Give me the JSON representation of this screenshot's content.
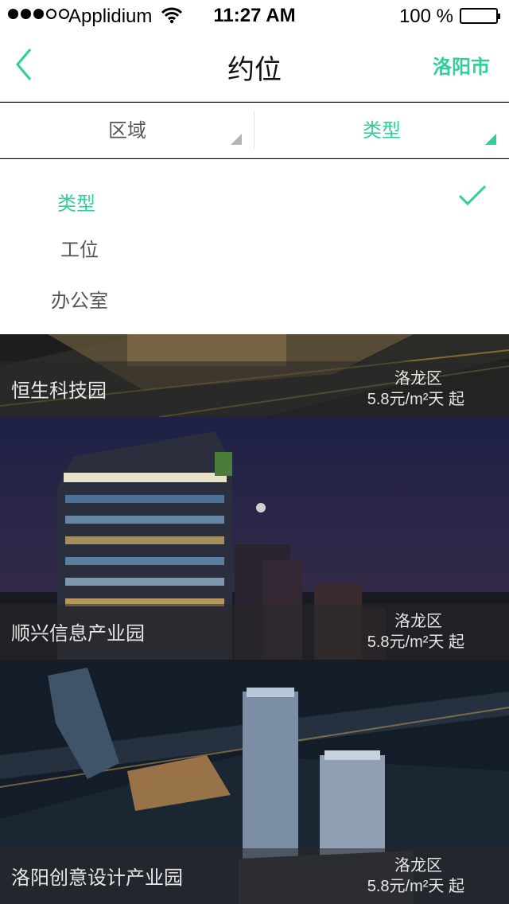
{
  "status_bar": {
    "carrier": "Applidium",
    "time": "11:27 AM",
    "battery": "100 %"
  },
  "nav": {
    "title": "约位",
    "city": "洛阳市",
    "back_icon": "chevron-left-icon"
  },
  "filters": {
    "area_label": "区域",
    "type_label": "类型",
    "active": "type"
  },
  "dropdown": {
    "options": [
      {
        "label": "类型",
        "selected": true
      },
      {
        "label": "工位",
        "selected": false
      },
      {
        "label": "办公室",
        "selected": false
      }
    ]
  },
  "listings": [
    {
      "name": "恒生科技园",
      "district": "洛龙区",
      "price": "5.8元/m²天 起"
    },
    {
      "name": "顺兴信息产业园",
      "district": "洛龙区",
      "price": "5.8元/m²天 起"
    },
    {
      "name": "洛阳创意设计产业园",
      "district": "洛龙区",
      "price": "5.8元/m²天 起"
    }
  ],
  "colors": {
    "accent": "#2ecf9a",
    "text": "#555555",
    "white": "#ffffff"
  }
}
